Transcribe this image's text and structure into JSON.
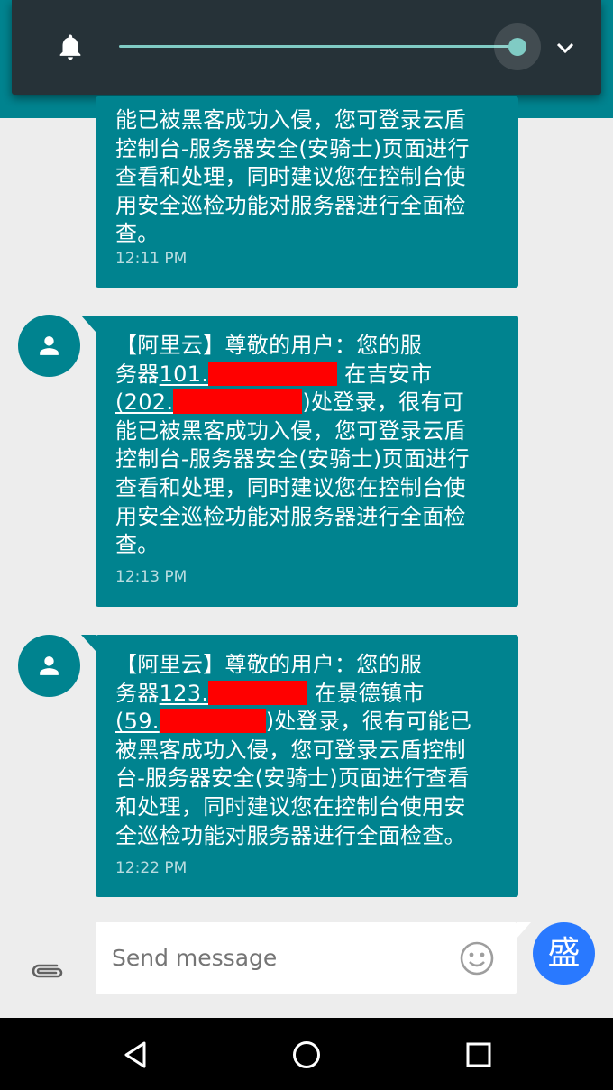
{
  "volume_panel": {
    "level": 1.0,
    "icons": {
      "left": "bell-icon",
      "right": "chevron-down-icon"
    },
    "accent_color": "#80cbc4"
  },
  "messages": [
    {
      "partial": true,
      "lines": [
        "能已被黑客成功入侵，您可登录云盾",
        "控制台-服务器安全(安骑士)页面进行",
        "查看和处理，同时建议您在控制台使",
        "用安全巡检功能对服务器进行全面检",
        "查。"
      ],
      "time": "12:11 PM"
    },
    {
      "prefix1": "【阿里云】尊敬的用户：您的服",
      "prefix2": "务器",
      "ip1": "101.",
      "mid": " 在吉安市",
      "ip2_open": "(",
      "ip2": "202.",
      "after": ")处登录，很有可",
      "rest": [
        "能已被黑客成功入侵，您可登录云盾",
        "控制台-服务器安全(安骑士)页面进行",
        "查看和处理，同时建议您在控制台使",
        "用安全巡检功能对服务器进行全面检",
        "查。"
      ],
      "time": "12:13 PM"
    },
    {
      "prefix1": "【阿里云】尊敬的用户：您的服",
      "prefix2": "务器",
      "ip1": "123.",
      "mid": " 在景德镇市",
      "ip2_open": "(",
      "ip2": "59.",
      "after": ")处登录，很有可能已",
      "rest": [
        "被黑客成功入侵，您可登录云盾控制",
        "台-服务器安全(安骑士)页面进行查看",
        "和处理，同时建议您在控制台使用安",
        "全巡检功能对服务器进行全面检查。"
      ],
      "time": "12:22 PM"
    }
  ],
  "composer": {
    "placeholder": "Send message",
    "send_avatar_char": "盛",
    "icons": {
      "attach": "paperclip-icon",
      "emoji": "smiley-icon"
    }
  },
  "navbar": {
    "icons": [
      "back-icon",
      "home-icon",
      "recents-icon"
    ]
  },
  "colors": {
    "bubble": "#00838f",
    "background": "#ededed",
    "send_avatar": "#2979ff",
    "redaction": "#ff0000"
  }
}
